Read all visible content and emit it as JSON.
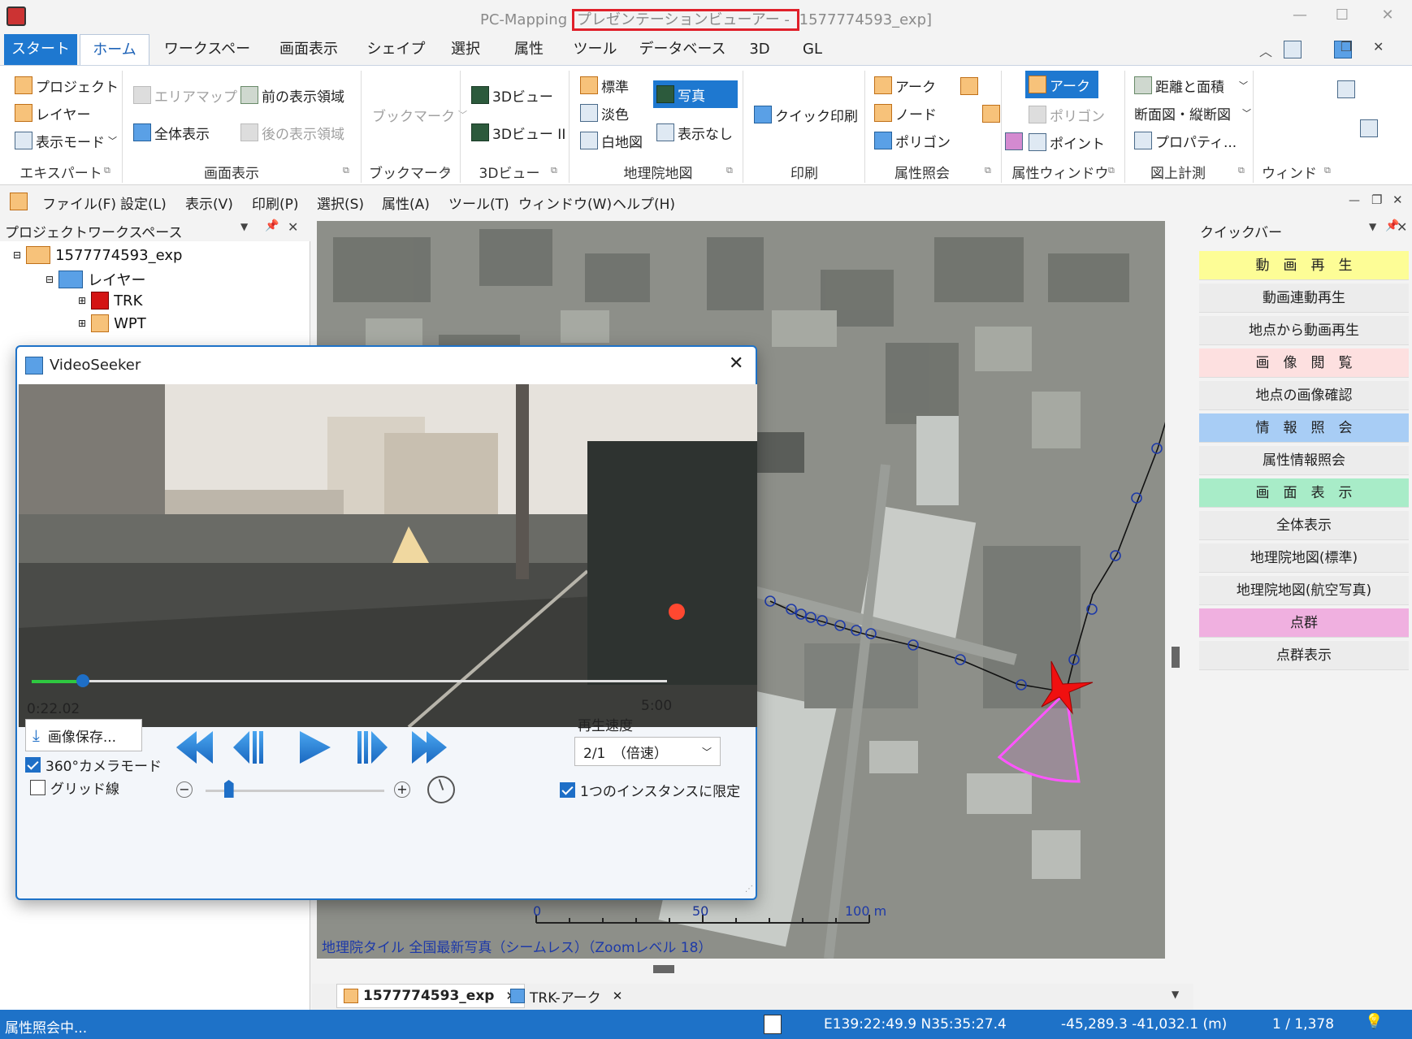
{
  "window": {
    "title_prefix": "PC-Mapping ",
    "title_highlight": "プレゼンテーションビューアー - ",
    "title_suffix": "1577774593_exp]",
    "minimize": "—",
    "maximize": "☐",
    "close": "✕"
  },
  "ribbon_tabs": [
    "スタート",
    "ホーム",
    "ワークスペース",
    "画面表示",
    "シェイプ",
    "選択",
    "属性",
    "ツール",
    "データベース",
    "3D",
    "GL"
  ],
  "ribbon": {
    "g1": {
      "b1": "プロジェクト",
      "b2": "レイヤー",
      "b3": "表示モード",
      "label": "エキスパート"
    },
    "g2": {
      "b1": "エリアマップ",
      "b2": "全体表示",
      "b3": "前の表示領域",
      "b4": "後の表示領域",
      "label": "画面表示"
    },
    "g3": {
      "b1": "ブックマーク",
      "label": "ブックマーク"
    },
    "g4": {
      "b1": "3Dビュー",
      "b2": "3Dビュー II",
      "label": "3Dビュー"
    },
    "g5": {
      "b1": "標準",
      "b2": "淡色",
      "b3": "白地図",
      "b4": "写真",
      "b5": "表示なし",
      "label": "地理院地図"
    },
    "g6": {
      "b1": "クイック印刷",
      "label": "印刷"
    },
    "g7": {
      "b1": "アーク",
      "b2": "ノード",
      "b3": "ポリゴン",
      "label": "属性照会"
    },
    "g8": {
      "b1": "アーク",
      "b2": "ポリゴン",
      "b3": "ポイント",
      "label": "属性ウィンドウ"
    },
    "g9": {
      "b1": "距離と面積",
      "b2": "断面図・縦断図",
      "b3": "プロパティ...",
      "label": "図上計測"
    },
    "g10": {
      "label": "ウィンドウ"
    }
  },
  "menubar": [
    "ファイル(F)",
    "設定(L)",
    "表示(V)",
    "印刷(P)",
    "選択(S)",
    "属性(A)",
    "ツール(T)",
    "ウィンドウ(W)",
    "ヘルプ(H)"
  ],
  "left_panel": {
    "title": "プロジェクトワークスペース",
    "tree": {
      "root": "1577774593_exp",
      "layers": "レイヤー",
      "trk": "TRK",
      "wpt": "WPT"
    }
  },
  "quickbar": {
    "title": "クイックバー",
    "items": [
      {
        "label": "動　画　再　生",
        "color": "#fdfd96"
      },
      {
        "label": "動画連動再生",
        "color": "#ececec"
      },
      {
        "label": "地点から動画再生",
        "color": "#ececec"
      },
      {
        "label": "画　像　閲　覧",
        "color": "#fde0e0"
      },
      {
        "label": "地点の画像確認",
        "color": "#ececec"
      },
      {
        "label": "情　報　照　会",
        "color": "#a8cdf5"
      },
      {
        "label": "属性情報照会",
        "color": "#ececec"
      },
      {
        "label": "画　面　表　示",
        "color": "#a8ecc8"
      },
      {
        "label": "全体表示",
        "color": "#ececec"
      },
      {
        "label": "地理院地図(標準)",
        "color": "#ececec"
      },
      {
        "label": "地理院地図(航空写真)",
        "color": "#ececec"
      },
      {
        "label": "点群",
        "color": "#f0b0e0"
      },
      {
        "label": "点群表示",
        "color": "#ececec"
      }
    ]
  },
  "map": {
    "credit": "地理院タイル 全国最新写真（シームレス）（Zoomレベル 18）",
    "scale_0": "0",
    "scale_50": "50",
    "scale_100": "100 m"
  },
  "doc_tabs": {
    "tab1": "1577774593_exp",
    "tab2": "TRK-アーク"
  },
  "status": {
    "message": "属性照会中...",
    "lonlat": "E139:22:49.9 N35:35:27.4",
    "xy": "-45,289.3 -41,032.1 (m)",
    "scale": "1 / 1,378"
  },
  "videoseeker": {
    "title": "VideoSeeker",
    "current_time": "0:22.02",
    "total_time": "5:00",
    "progress": 0.08,
    "save_button": "画像保存...",
    "camera_mode": "360°カメラモード",
    "camera_mode_checked": true,
    "grid": "グリッド線",
    "grid_checked": false,
    "speed_label": "再生速度",
    "speed_value": "2/1　（倍速）",
    "single_instance": "1つのインスタンスに限定",
    "single_instance_checked": true,
    "zoom_level": 0.13
  }
}
